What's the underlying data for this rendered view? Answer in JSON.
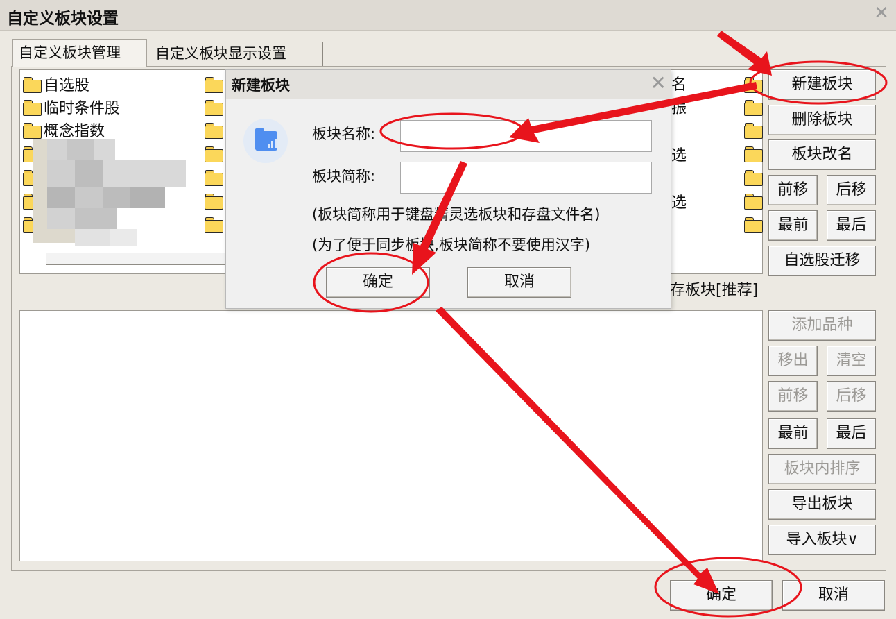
{
  "window": {
    "title": "自定义板块设置"
  },
  "tabs": [
    {
      "label": "自定义板块管理"
    },
    {
      "label": "自定义板块显示设置"
    }
  ],
  "block_list": {
    "items": [
      "自选股",
      "临时条件股",
      "概念指数"
    ],
    "partial_texts": [
      "名",
      "振",
      "选",
      "选"
    ],
    "caption_partial": "存板块[推荐]"
  },
  "right_buttons": {
    "new_block": "新建板块",
    "delete_block": "删除板块",
    "rename_block": "板块改名",
    "move_forward": "前移",
    "move_backward": "后移",
    "move_first": "最前",
    "move_last": "最后",
    "migrate_watchlist": "自选股迁移"
  },
  "lower_buttons": {
    "add_item": "添加品种",
    "remove": "移出",
    "clear": "清空",
    "move_forward": "前移",
    "move_backward": "后移",
    "move_first": "最前",
    "move_last": "最后",
    "sort_in_block": "板块内排序",
    "export_block": "导出板块",
    "import_block": "导入板块∨"
  },
  "dialog": {
    "title": "新建板块",
    "name_label": "板块名称:",
    "name_value": "",
    "short_label": "板块简称:",
    "short_value": "",
    "note1": "(板块简称用于键盘精灵选板块和存盘文件名)",
    "note2": "(为了便于同步板块,板块简称不要使用汉字)",
    "ok": "确定",
    "cancel": "取消"
  },
  "footer": {
    "ok": "确定",
    "cancel": "取消"
  },
  "colors": {
    "annotation": "#e8141c",
    "folder": "#fbd75a",
    "dialog_icon": "#4f8ef0"
  },
  "icons": {
    "folder": "folder-icon",
    "close": "close-icon",
    "dialog": "folder-chart-icon"
  }
}
